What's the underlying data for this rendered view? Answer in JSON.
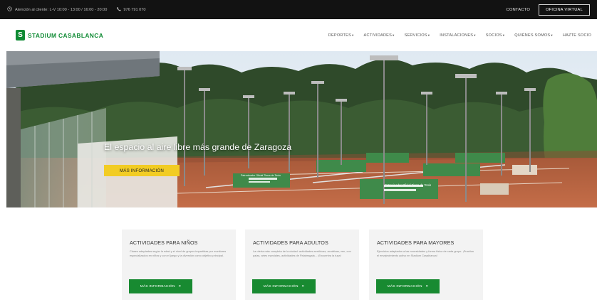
{
  "topbar": {
    "hours": "Atención al cliente: L-V 10:00 - 13:00 / 16:00 - 20:00",
    "phone": "976 791 070",
    "contact": "CONTACTO",
    "oficina": "OFICINA VIRTUAL"
  },
  "header": {
    "logo_text": "STADIUM CASABLANCA",
    "nav": [
      {
        "label": "DEPORTES"
      },
      {
        "label": "ACTIVIDADES"
      },
      {
        "label": "SERVICIOS"
      },
      {
        "label": "INSTALACIONES"
      },
      {
        "label": "SOCIOS"
      },
      {
        "label": "QUIÉNES SOMOS"
      },
      {
        "label": "HAZTE SOCIO"
      }
    ]
  },
  "hero": {
    "title": "El espacio al aire libre más grande de Zaragoza",
    "button": "MÁS INFORMACIÓN"
  },
  "cards": [
    {
      "title": "ACTIVIDADES PARA NIÑOS",
      "text": "Clases adaptadas según la edad y el nivel de grupos impartidas por monitores especializados en niños y con el juego y la diversión como objetivo principal.",
      "button": "MÁS INFORMACIÓN"
    },
    {
      "title": "ACTIVIDADES PARA ADULTOS",
      "text": "La oferta más completa de la ciudad: actividades aeróbicas, acuáticas, zen, con palas, artes marciales, actividades de Palabragala... ¡Encuentra la tuya!",
      "button": "MÁS INFORMACIÓN"
    },
    {
      "title": "ACTIVIDADES PARA MAYORES",
      "text": "Ejercicios adaptados a las necesidades y forma física de cada grupo. ¡Practica el envejecimiento activo en Stadium Casablanca!",
      "button": "MÁS INFORMACIÓN"
    }
  ],
  "banners": [
    "Patrocinador Oficial Tierra de Tenis",
    "Patrocinador Oficial Tierra de Tenis"
  ],
  "colors": {
    "brand_green": "#0e8a33",
    "button_green": "#188a31",
    "hero_button": "#f2cc24",
    "topbar": "#121212",
    "clay": "#b8603e"
  }
}
